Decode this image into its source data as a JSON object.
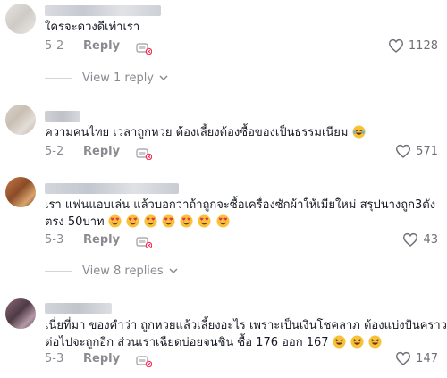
{
  "comments": [
    {
      "text": "ใครจะดวงดีเท่าเรา",
      "date": "5-2",
      "reply_label": "Reply",
      "likes": "1128"
    },
    {
      "text": "ความคนไทย เวลาถูกหวย ต้องเลี้ยงต้องซื้อของเป็นธรรมเนียม",
      "date": "5-2",
      "reply_label": "Reply",
      "likes": "571"
    },
    {
      "text_line1": "เรา แฟนแอบเล่น แล้วบอกว่าถ้าถูกจะซื้อเครื่องซักผ้าให้เมียใหม่ สรุปนางถูก3ตัง",
      "text_line2": "ตรง 50บาท",
      "date": "5-3",
      "reply_label": "Reply",
      "likes": "43"
    },
    {
      "text_line1": "เนี่ยที่มา ของคำว่า ถูกหวยแล้วเลี้ยงอะไร เพราะเป็นเงินโชคลาภ ต้องแบ่งปันคราว",
      "text_line2": "ต่อไปจะถูกอีก ส่วนเราเฉียดบ่อยจนชิน ซื้อ 176 ออก 167",
      "date": "5-3",
      "reply_label": "Reply",
      "likes": "147"
    }
  ],
  "view_replies": [
    {
      "label": "View 1 reply"
    },
    {
      "label": "View 8 replies"
    }
  ],
  "icons": {
    "heart": "heart-outline-icon",
    "chevron": "chevron-down-icon",
    "sticker": "sticker-reply-icon"
  },
  "colors": {
    "text": "#161823",
    "muted": "#8a8b91",
    "accent": "#fe2c55"
  }
}
